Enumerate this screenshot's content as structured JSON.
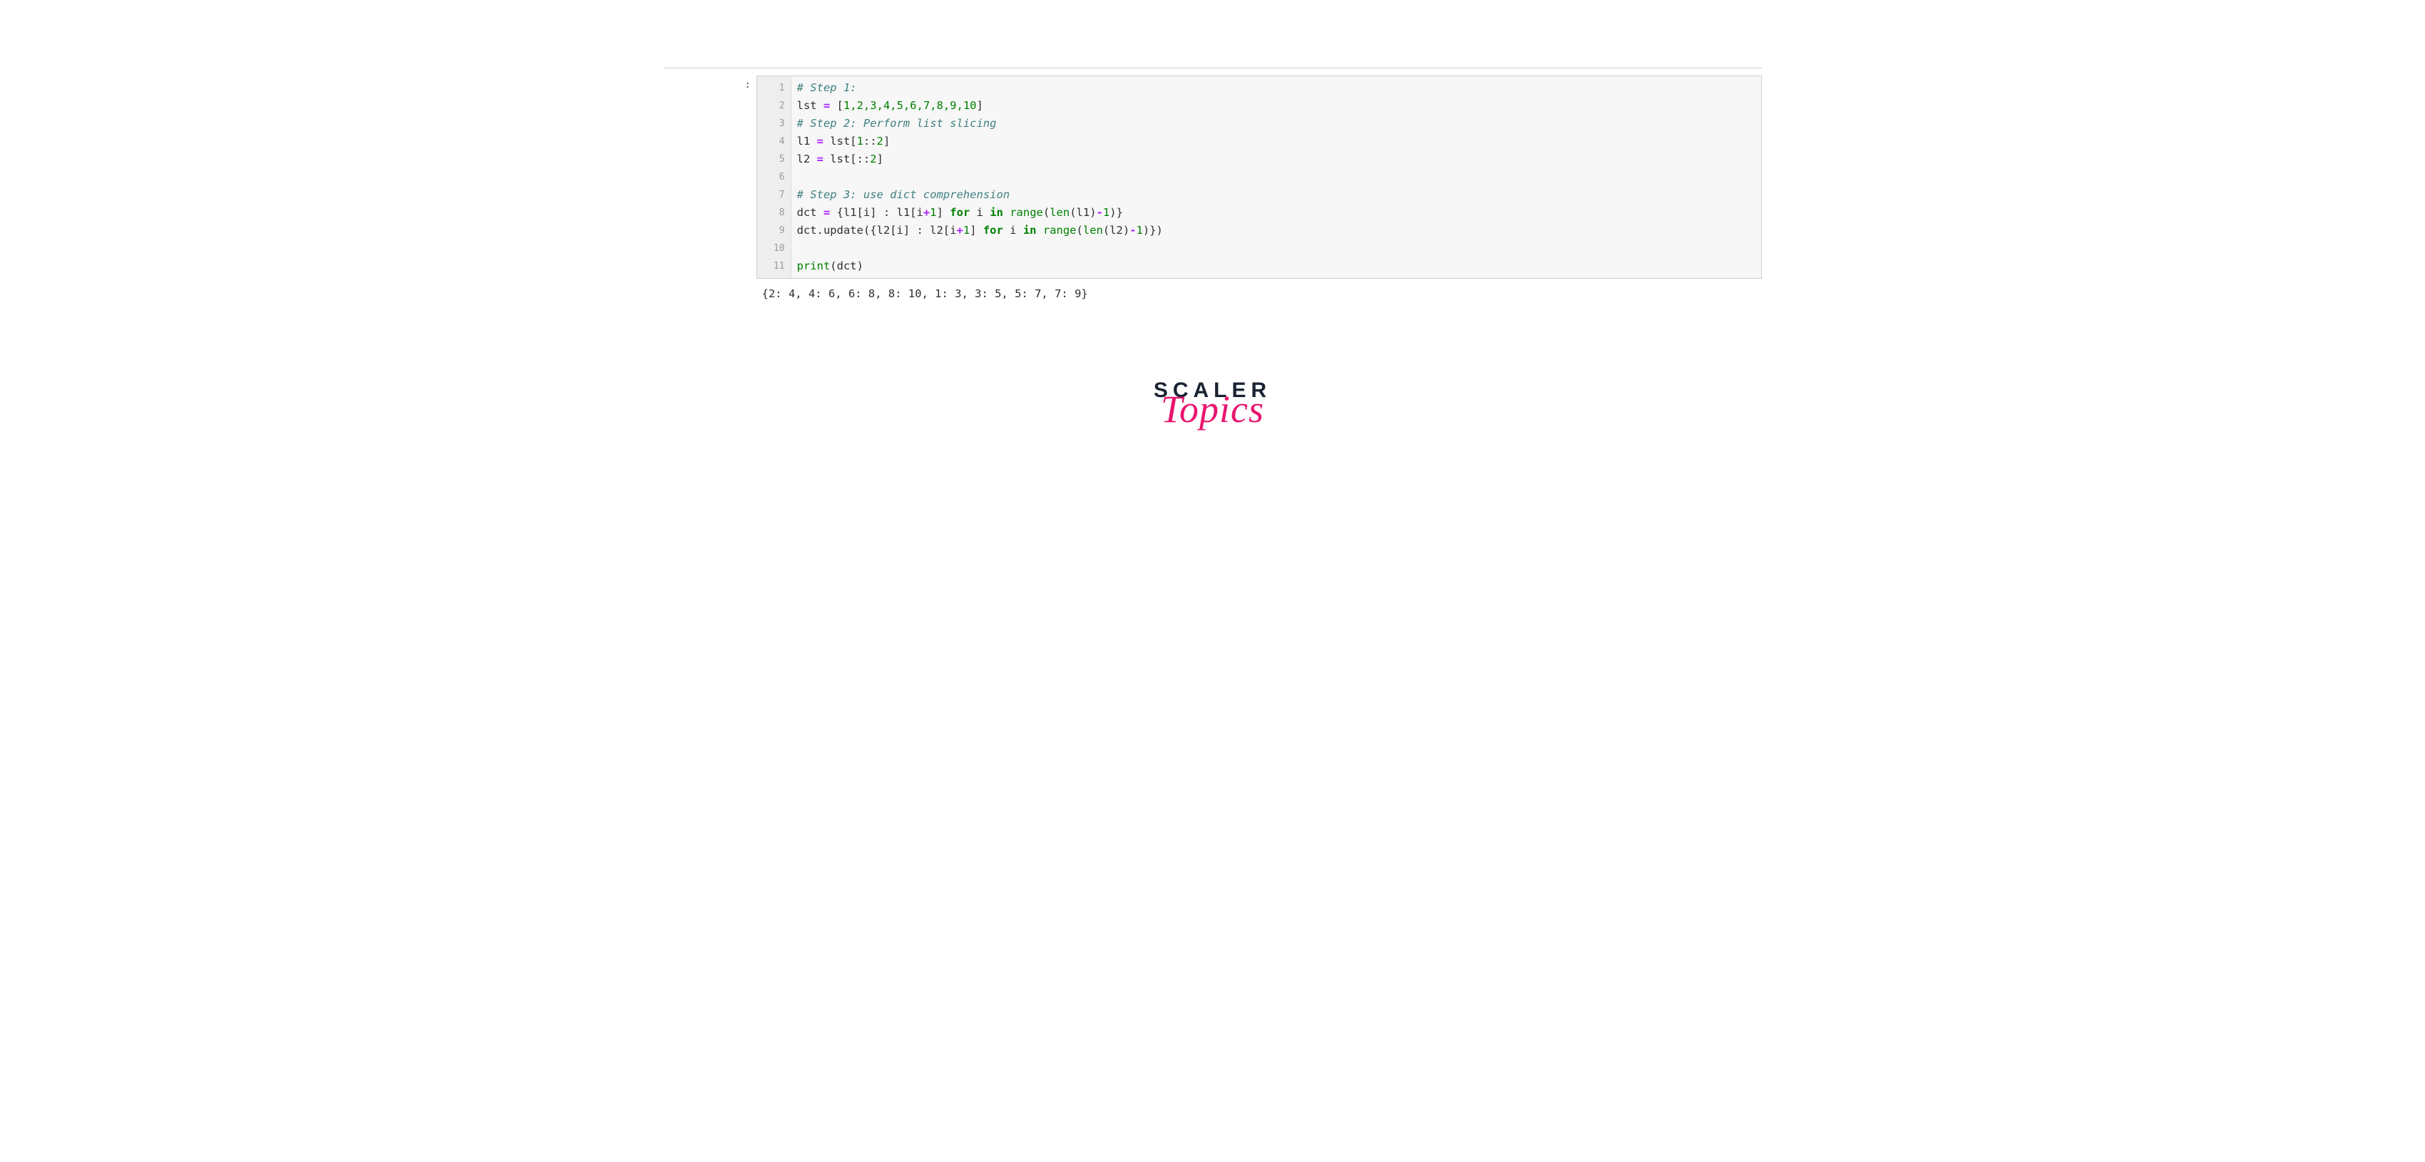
{
  "prompt": {
    "label": " :"
  },
  "gutter": {
    "lines": [
      "1",
      "2",
      "3",
      "4",
      "5",
      "6",
      "7",
      "8",
      "9",
      "10",
      "11"
    ]
  },
  "code": {
    "l1_comment": "# Step 1:",
    "l2_a": "lst ",
    "l2_op": "=",
    "l2_b": " [",
    "l2_nums": "1,2,3,4,5,6,7,8,9,10",
    "l2_c": "]",
    "l3_comment": "# Step 2: Perform list slicing",
    "l4_a": "l1 ",
    "l4_op": "=",
    "l4_b": " lst[",
    "l4_n1": "1",
    "l4_c": "::",
    "l4_n2": "2",
    "l4_d": "]",
    "l5_a": "l2 ",
    "l5_op": "=",
    "l5_b": " lst[::",
    "l5_n": "2",
    "l5_c": "]",
    "l6": "",
    "l7_comment": "# Step 3: use dict comprehension",
    "l8_a": "dct ",
    "l8_op": "=",
    "l8_b": " {l1[i] : l1[i",
    "l8_plus": "+",
    "l8_n1": "1",
    "l8_c": "] ",
    "l8_for": "for",
    "l8_d": " i ",
    "l8_in": "in",
    "l8_e": " ",
    "l8_range": "range",
    "l8_f": "(",
    "l8_len": "len",
    "l8_g": "(l1)",
    "l8_minus": "-",
    "l8_n2": "1",
    "l8_h": ")}",
    "l9_a": "dct.update({l2[i] : l2[i",
    "l9_plus": "+",
    "l9_n1": "1",
    "l9_b": "] ",
    "l9_for": "for",
    "l9_c": " i ",
    "l9_in": "in",
    "l9_d": " ",
    "l9_range": "range",
    "l9_e": "(",
    "l9_len": "len",
    "l9_f": "(l2)",
    "l9_minus": "-",
    "l9_n2": "1",
    "l9_g": ")})",
    "l10": "",
    "l11_print": "print",
    "l11_b": "(dct)"
  },
  "output": {
    "text": "{2: 4, 4: 6, 6: 8, 8: 10, 1: 3, 3: 5, 5: 7, 7: 9}"
  },
  "logo": {
    "line1": "SCALER",
    "line2": "Topics"
  }
}
